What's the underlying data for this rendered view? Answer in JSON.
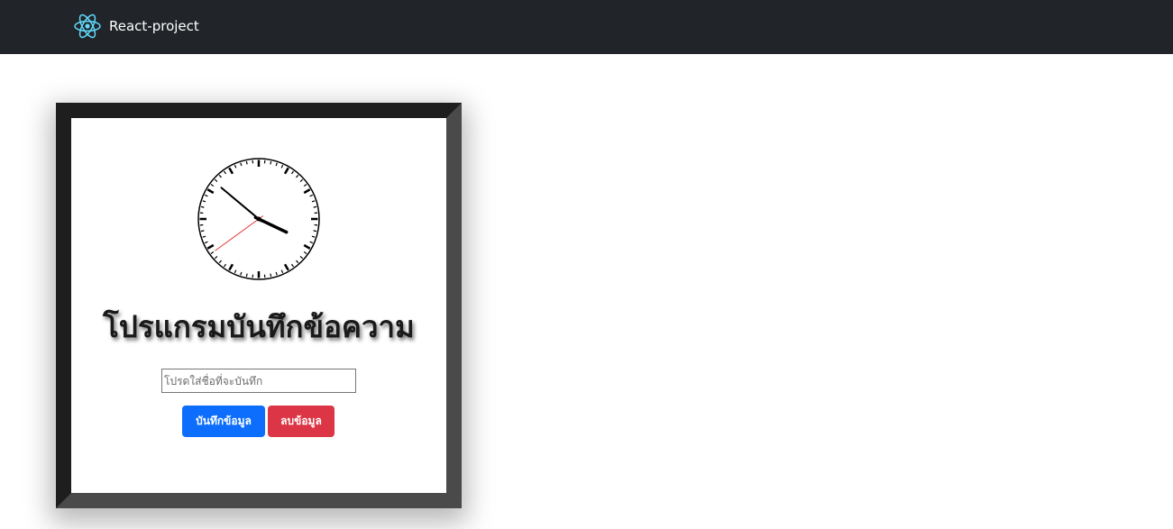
{
  "navbar": {
    "brand_icon": "react-atom-icon",
    "brand_label": "React-project",
    "background": "#212529",
    "icon_color": "#61dafb"
  },
  "clock": {
    "icon": "analog-clock",
    "hour": 3,
    "minute": 51,
    "second": 39,
    "second_hand_color": "#e53935"
  },
  "main": {
    "title": "โปรแกรมบันทึกข้อความ",
    "name_input": {
      "value": "",
      "placeholder": "โปรดใส่ชื่อที่จะบันทึก"
    },
    "save_button_label": "บันทึกข้อมูล",
    "delete_button_label": "ลบข้อมูล",
    "save_button_color": "#0d6efd",
    "delete_button_color": "#dc3545"
  }
}
